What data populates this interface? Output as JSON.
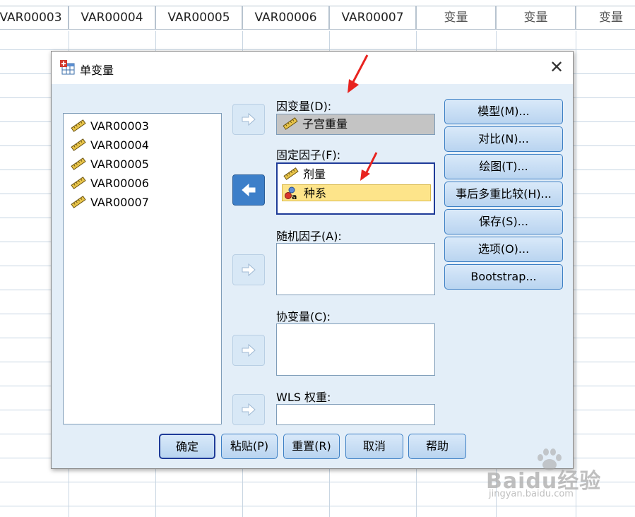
{
  "sheet": {
    "columns": [
      "VAR00003",
      "VAR00004",
      "VAR00005",
      "VAR00006",
      "VAR00007",
      "变量",
      "变量",
      "变量"
    ]
  },
  "dialog": {
    "title": "单变量",
    "close_glyph": "✕",
    "variables": [
      "VAR00003",
      "VAR00004",
      "VAR00005",
      "VAR00006",
      "VAR00007"
    ],
    "dependent": {
      "label": "因变量(D):",
      "value": "子宫重量"
    },
    "fixed_factors": {
      "label": "固定因子(F):",
      "items": [
        "剂量",
        "种系"
      ],
      "selected": "种系"
    },
    "random_factors": {
      "label": "随机因子(A):"
    },
    "covariates": {
      "label": "协变量(C):"
    },
    "wls": {
      "label": "WLS 权重:"
    },
    "side_buttons": [
      "模型(M)...",
      "对比(N)...",
      "绘图(T)...",
      "事后多重比较(H)...",
      "保存(S)...",
      "选项(O)...",
      "Bootstrap..."
    ],
    "bottom_buttons": [
      "确定",
      "粘贴(P)",
      "重置(R)",
      "取消",
      "帮助"
    ]
  },
  "watermark": {
    "text": "Baidu经验",
    "url_text": "jingyan.baidu.com"
  },
  "colors": {
    "dialog_bg": "#e3eef8",
    "button_border": "#3c7fc4",
    "selection": "#fde48a",
    "annotation": "#e8231f"
  }
}
